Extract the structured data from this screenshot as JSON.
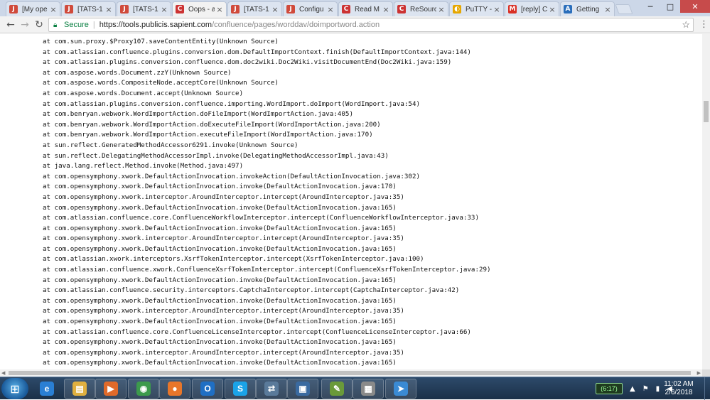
{
  "browser": {
    "tabs": [
      {
        "title": "[My ope",
        "icon": "J",
        "color": "#d04a3b",
        "active": false
      },
      {
        "title": "[TATS-1",
        "icon": "J",
        "color": "#d04a3b",
        "active": false
      },
      {
        "title": "[TATS-1",
        "icon": "J",
        "color": "#d04a3b",
        "active": false
      },
      {
        "title": "Oops - a",
        "icon": "C",
        "color": "#cc3333",
        "active": true
      },
      {
        "title": "[TATS-1",
        "icon": "J",
        "color": "#d04a3b",
        "active": false
      },
      {
        "title": "Configu",
        "icon": "J",
        "color": "#d04a3b",
        "active": false
      },
      {
        "title": "Read M",
        "icon": "C",
        "color": "#cc3333",
        "active": false
      },
      {
        "title": "ReSourc",
        "icon": "C",
        "color": "#cc3333",
        "active": false
      },
      {
        "title": "PuTTY -",
        "icon": "◐",
        "color": "#e6a700",
        "active": false
      },
      {
        "title": "[reply] C",
        "icon": "M",
        "color": "#d93025",
        "active": false
      },
      {
        "title": "Getting",
        "icon": "A",
        "color": "#2a6ebb",
        "active": false
      }
    ],
    "window": {
      "minimize": "─",
      "maximize": "□",
      "close": "✕"
    },
    "toolbar": {
      "back": "←",
      "forward": "→",
      "reload": "↻",
      "secure_label": "Secure",
      "url_host": "https://tools.publicis.sapient.com",
      "url_path": "/confluence/pages/worddav/doimportword.action",
      "star": "☆",
      "menu": "⋮"
    }
  },
  "content": {
    "lines": [
      "at com.sun.proxy.$Proxy107.saveContentEntity(Unknown Source)",
      "at com.atlassian.confluence.plugins.conversion.dom.DefaultImportContext.finish(DefaultImportContext.java:144)",
      "at com.atlassian.plugins.conversion.confluence.dom.doc2wiki.Doc2Wiki.visitDocumentEnd(Doc2Wiki.java:159)",
      "at com.aspose.words.Document.zzY(Unknown Source)",
      "at com.aspose.words.CompositeNode.acceptCore(Unknown Source)",
      "at com.aspose.words.Document.accept(Unknown Source)",
      "at com.atlassian.plugins.conversion.confluence.importing.WordImport.doImport(WordImport.java:54)",
      "at com.benryan.webwork.WordImportAction.doFileImport(WordImportAction.java:405)",
      "at com.benryan.webwork.WordImportAction.doExecuteFileImport(WordImportAction.java:200)",
      "at com.benryan.webwork.WordImportAction.executeFileImport(WordImportAction.java:170)",
      "at sun.reflect.GeneratedMethodAccessor6291.invoke(Unknown Source)",
      "at sun.reflect.DelegatingMethodAccessorImpl.invoke(DelegatingMethodAccessorImpl.java:43)",
      "at java.lang.reflect.Method.invoke(Method.java:497)",
      "at com.opensymphony.xwork.DefaultActionInvocation.invokeAction(DefaultActionInvocation.java:302)",
      "at com.opensymphony.xwork.DefaultActionInvocation.invoke(DefaultActionInvocation.java:170)",
      "at com.opensymphony.xwork.interceptor.AroundInterceptor.intercept(AroundInterceptor.java:35)",
      "at com.opensymphony.xwork.DefaultActionInvocation.invoke(DefaultActionInvocation.java:165)",
      "at com.atlassian.confluence.core.ConfluenceWorkflowInterceptor.intercept(ConfluenceWorkflowInterceptor.java:33)",
      "at com.opensymphony.xwork.DefaultActionInvocation.invoke(DefaultActionInvocation.java:165)",
      "at com.opensymphony.xwork.interceptor.AroundInterceptor.intercept(AroundInterceptor.java:35)",
      "at com.opensymphony.xwork.DefaultActionInvocation.invoke(DefaultActionInvocation.java:165)",
      "at com.atlassian.xwork.interceptors.XsrfTokenInterceptor.intercept(XsrfTokenInterceptor.java:100)",
      "at com.atlassian.confluence.xwork.ConfluenceXsrfTokenInterceptor.intercept(ConfluenceXsrfTokenInterceptor.java:29)",
      "at com.opensymphony.xwork.DefaultActionInvocation.invoke(DefaultActionInvocation.java:165)",
      "at com.atlassian.confluence.security.interceptors.CaptchaInterceptor.intercept(CaptchaInterceptor.java:42)",
      "at com.opensymphony.xwork.DefaultActionInvocation.invoke(DefaultActionInvocation.java:165)",
      "at com.opensymphony.xwork.interceptor.AroundInterceptor.intercept(AroundInterceptor.java:35)",
      "at com.opensymphony.xwork.DefaultActionInvocation.invoke(DefaultActionInvocation.java:165)",
      "at com.atlassian.confluence.core.ConfluenceLicenseInterceptor.intercept(ConfluenceLicenseInterceptor.java:66)",
      "at com.opensymphony.xwork.DefaultActionInvocation.invoke(DefaultActionInvocation.java:165)",
      "at com.opensymphony.xwork.interceptor.AroundInterceptor.intercept(AroundInterceptor.java:35)",
      "at com.opensymphony.xwork.DefaultActionInvocation.invoke(DefaultActionInvocation.java:165)"
    ]
  },
  "taskbar": {
    "apps": [
      {
        "name": "ie-icon",
        "glyph": "e",
        "color": "#2a7fd4"
      },
      {
        "name": "file-explorer-icon",
        "glyph": "▤",
        "color": "#e0b040"
      },
      {
        "name": "media-player-icon",
        "glyph": "▶",
        "color": "#e06a2a"
      },
      {
        "name": "chrome-icon",
        "glyph": "◉",
        "color": "#3c9a4c"
      },
      {
        "name": "firefox-icon",
        "glyph": "●",
        "color": "#e8762a"
      },
      {
        "name": "outlook-icon",
        "glyph": "O",
        "color": "#1f6fc4"
      },
      {
        "name": "skype-icon",
        "glyph": "S",
        "color": "#1aa3e8"
      },
      {
        "name": "network-tool-icon",
        "glyph": "⇄",
        "color": "#5a7a9a"
      },
      {
        "name": "remote-desktop-icon",
        "glyph": "▣",
        "color": "#3a6aa0"
      },
      {
        "name": "notepad-icon",
        "glyph": "✎",
        "color": "#6a9a3a"
      },
      {
        "name": "calendar-icon",
        "glyph": "▦",
        "color": "#8a8a8a"
      },
      {
        "name": "app-icon",
        "glyph": "➤",
        "color": "#3a8ad4"
      }
    ],
    "battery": "(6:17)",
    "clock_time": "11:02 AM",
    "clock_date": "2/6/2018"
  }
}
